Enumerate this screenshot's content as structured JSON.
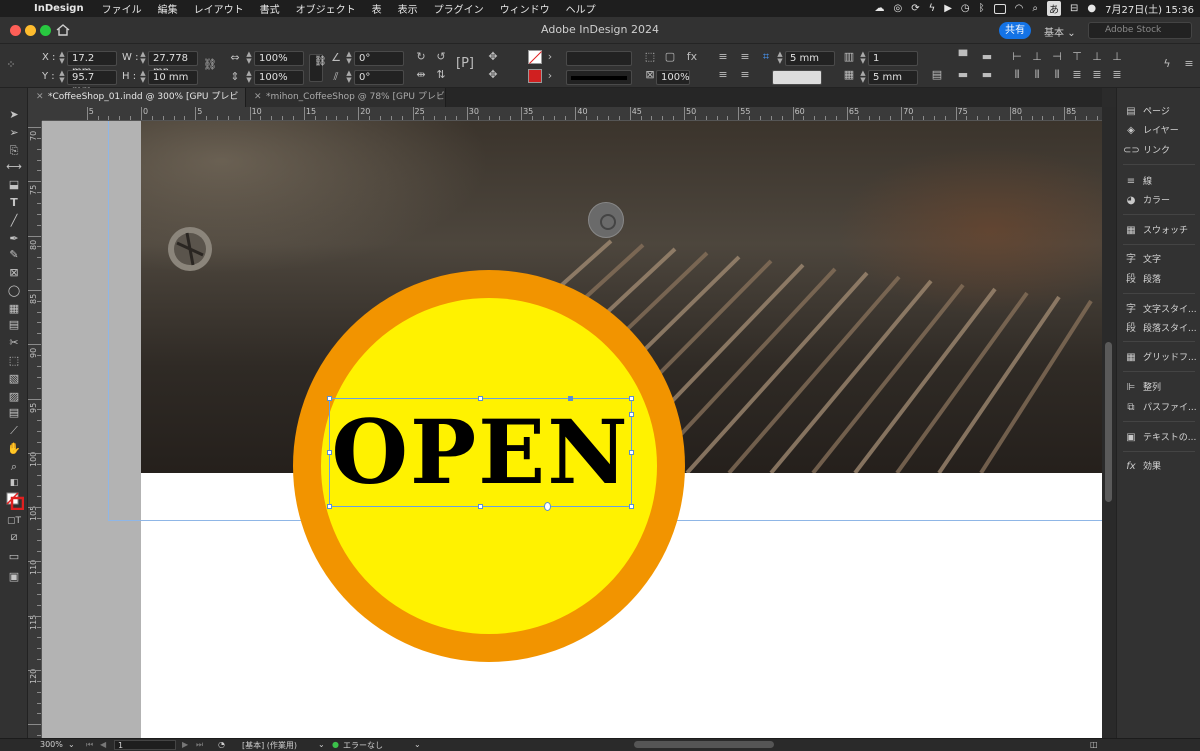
{
  "menubar": {
    "app": "InDesign",
    "items": [
      "ファイル",
      "編集",
      "レイアウト",
      "書式",
      "オブジェクト",
      "表",
      "表示",
      "プラグイン",
      "ウィンドウ",
      "ヘルプ"
    ],
    "input_mode": "あ",
    "datetime": "7月27日(土) 15:36"
  },
  "titlebar": {
    "title": "Adobe InDesign 2024",
    "share_label": "共有",
    "workspace_label": "基本",
    "stock_placeholder": "Adobe Stock"
  },
  "control": {
    "x_label": "X :",
    "x_value": "17.2 mm",
    "y_label": "Y :",
    "y_value": "95.7 mm",
    "w_label": "W :",
    "w_value": "27.778 mn",
    "h_label": "H :",
    "h_value": "10 mm",
    "scale_x": "100%",
    "scale_y": "100%",
    "rotate": "0°",
    "shear": "0°",
    "opacity": "100%",
    "stroke_weight": "",
    "inset_top": "5 mm",
    "inset_bottom": "5 mm",
    "columns": "1"
  },
  "tabs": [
    {
      "label": "*CoffeeShop_01.indd @ 300% [GPU プレビュー]",
      "active": true
    },
    {
      "label": "*mihon_CoffeeShop @ 78% [GPU プレビュー]",
      "active": false
    }
  ],
  "ruler": {
    "h": [
      "5",
      "0",
      "5",
      "10",
      "15",
      "20",
      "25",
      "30",
      "35",
      "40",
      "45",
      "50",
      "55",
      "60",
      "65",
      "70",
      "75",
      "80",
      "85"
    ],
    "v": [
      "70",
      "75",
      "80",
      "85",
      "90",
      "95",
      "100",
      "105",
      "110",
      "115",
      "120"
    ]
  },
  "canvas": {
    "badge_text": "OPEN",
    "badge_outer_color": "#f29400",
    "badge_inner_color": "#fff200"
  },
  "panels": [
    {
      "icon": "pages-icon",
      "label": "ページ"
    },
    {
      "icon": "layers-icon",
      "label": "レイヤー"
    },
    {
      "icon": "links-icon",
      "label": "リンク"
    },
    {
      "icon": "stroke-icon",
      "label": "線"
    },
    {
      "icon": "color-icon",
      "label": "カラー"
    },
    {
      "icon": "swatches-icon",
      "label": "スウォッチ"
    },
    {
      "icon": "character-icon",
      "label": "文字"
    },
    {
      "icon": "paragraph-icon",
      "label": "段落"
    },
    {
      "icon": "char-styles-icon",
      "label": "文字スタイ..."
    },
    {
      "icon": "para-styles-icon",
      "label": "段落スタイ..."
    },
    {
      "icon": "grid-format-icon",
      "label": "グリッドフ..."
    },
    {
      "icon": "align-icon",
      "label": "整列"
    },
    {
      "icon": "pathfinder-icon",
      "label": "パスファイ..."
    },
    {
      "icon": "text-wrap-icon",
      "label": "テキストの..."
    },
    {
      "icon": "effects-icon",
      "label": "効果"
    }
  ],
  "status": {
    "zoom": "300%",
    "page": "1",
    "preflight_profile": "[基本] (作業用)",
    "error_label": "エラーなし"
  }
}
